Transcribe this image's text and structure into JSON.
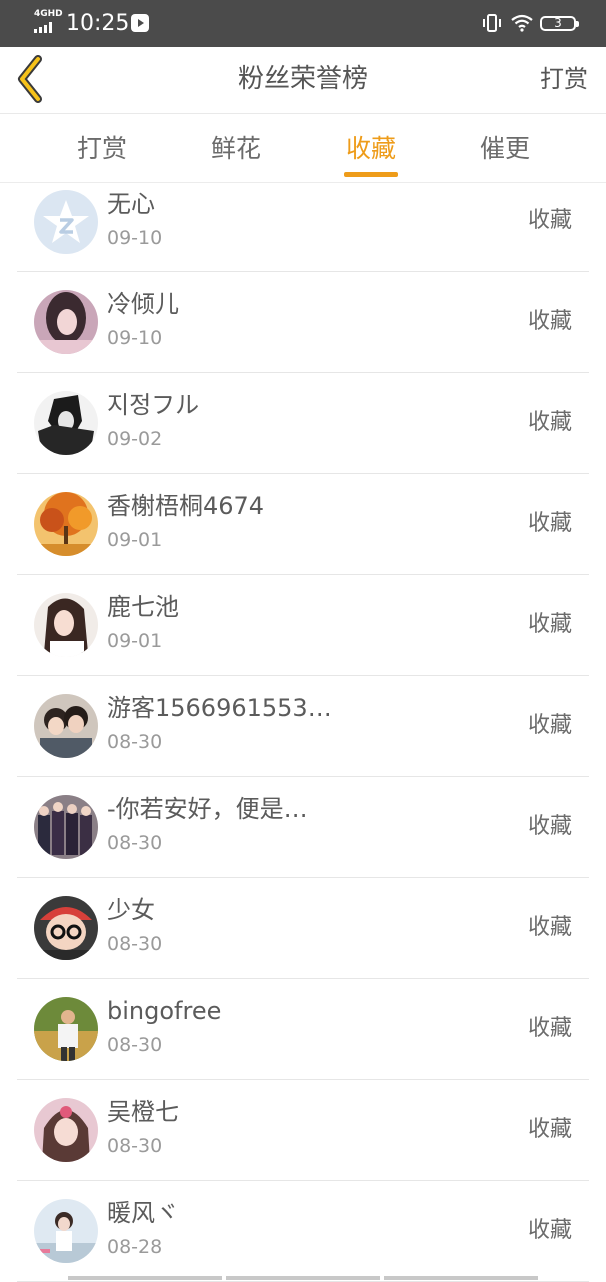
{
  "status_bar": {
    "network": "4GHD",
    "time": "10:25",
    "battery": "3"
  },
  "nav": {
    "title": "粉丝荣誉榜",
    "action": "打赏"
  },
  "tabs": [
    {
      "label": "打赏",
      "active": false
    },
    {
      "label": "鲜花",
      "active": false
    },
    {
      "label": "收藏",
      "active": true
    },
    {
      "label": "催更",
      "active": false
    }
  ],
  "list": [
    {
      "name": "无心",
      "date": "09-10",
      "action": "收藏",
      "avatar": "default-avatar"
    },
    {
      "name": "冷倾儿",
      "date": "09-10",
      "action": "收藏",
      "avatar": "user-photo"
    },
    {
      "name": "지정フル",
      "date": "09-02",
      "action": "收藏",
      "avatar": "user-photo"
    },
    {
      "name": "香榭梧桐4674",
      "date": "09-01",
      "action": "收藏",
      "avatar": "autumn-tree-photo"
    },
    {
      "name": "鹿七池",
      "date": "09-01",
      "action": "收藏",
      "avatar": "user-photo"
    },
    {
      "name": "游客1566961553…",
      "date": "08-30",
      "action": "收藏",
      "avatar": "couple-photo"
    },
    {
      "name": "-你若安好，便是…",
      "date": "08-30",
      "action": "收藏",
      "avatar": "group-photo"
    },
    {
      "name": "少女",
      "date": "08-30",
      "action": "收藏",
      "avatar": "user-photo"
    },
    {
      "name": "bingofree",
      "date": "08-30",
      "action": "收藏",
      "avatar": "user-photo"
    },
    {
      "name": "吴橙七",
      "date": "08-30",
      "action": "收藏",
      "avatar": "user-photo"
    },
    {
      "name": "暖风ヾ",
      "date": "08-28",
      "action": "收藏",
      "avatar": "user-photo"
    }
  ],
  "colors": {
    "accent": "#ee9c1a",
    "status_bar": "#4b4b4b"
  }
}
